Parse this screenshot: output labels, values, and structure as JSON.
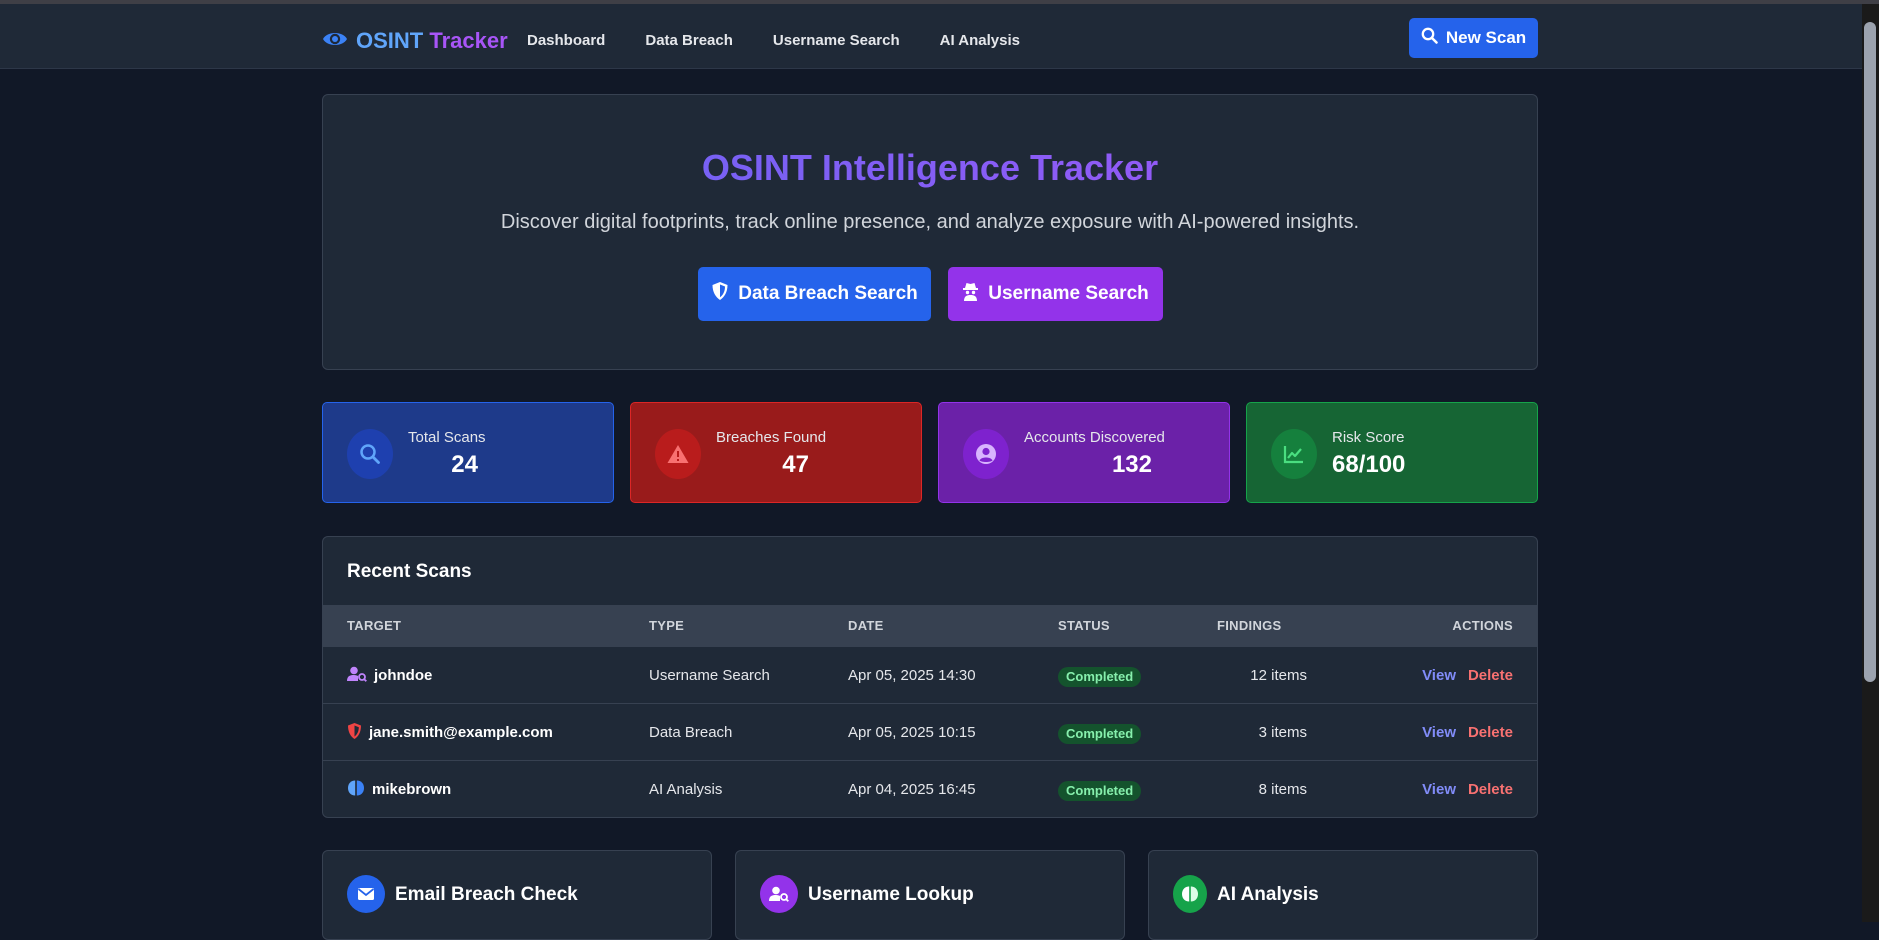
{
  "nav": {
    "brand_part1": "OSINT",
    "brand_part2": "Tracker",
    "links": [
      "Dashboard",
      "Data Breach",
      "Username Search",
      "AI Analysis"
    ],
    "new_scan": "New Scan"
  },
  "hero": {
    "title": "OSINT Intelligence Tracker",
    "subtitle": "Discover digital footprints, track online presence, and analyze exposure with AI-powered insights.",
    "btn_breach": "Data Breach Search",
    "btn_username": "Username Search"
  },
  "stats": [
    {
      "label": "Total Scans",
      "value": "24"
    },
    {
      "label": "Breaches Found",
      "value": "47"
    },
    {
      "label": "Accounts Discovered",
      "value": "132"
    },
    {
      "label": "Risk Score",
      "value": "68/100"
    }
  ],
  "recent": {
    "title": "Recent Scans",
    "headers": [
      "TARGET",
      "TYPE",
      "DATE",
      "STATUS",
      "FINDINGS",
      "ACTIONS"
    ],
    "rows": [
      {
        "target": "johndoe",
        "type": "Username Search",
        "date": "Apr 05, 2025 14:30",
        "status": "Completed",
        "findings": "12 items",
        "icon": "user-search-icon"
      },
      {
        "target": "jane.smith@example.com",
        "type": "Data Breach",
        "date": "Apr 05, 2025 10:15",
        "status": "Completed",
        "findings": "3 items",
        "icon": "shield-icon"
      },
      {
        "target": "mikebrown",
        "type": "AI Analysis",
        "date": "Apr 04, 2025 16:45",
        "status": "Completed",
        "findings": "8 items",
        "icon": "brain-icon"
      }
    ],
    "view": "View",
    "delete": "Delete"
  },
  "cards": [
    {
      "title": "Email Breach Check",
      "color": "#2563eb",
      "icon": "envelope-icon"
    },
    {
      "title": "Username Lookup",
      "color": "#9333ea",
      "icon": "user-search-icon"
    },
    {
      "title": "AI Analysis",
      "color": "#16a34a",
      "icon": "brain-icon"
    }
  ],
  "colors": {
    "background": "#111827",
    "panel": "#1f2937",
    "accent_blue": "#2563eb",
    "accent_purple": "#9333ea",
    "danger": "#dc2626",
    "success": "#16a34a"
  }
}
